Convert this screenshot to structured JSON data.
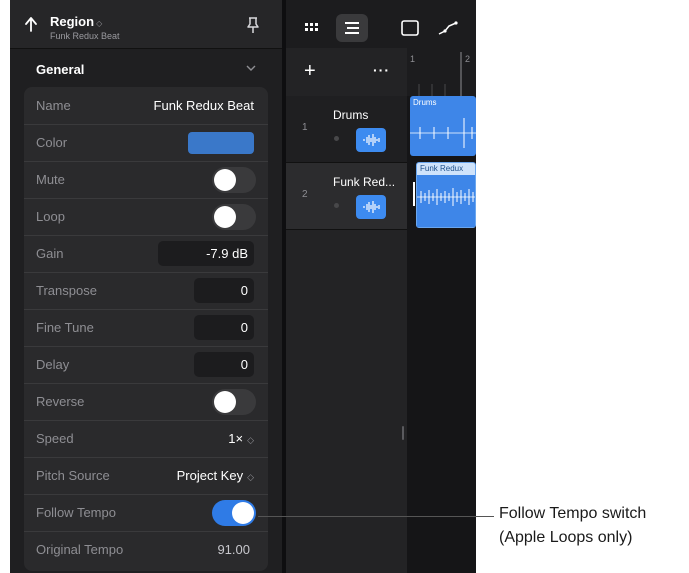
{
  "header": {
    "title": "Region",
    "title_chevron": "◇",
    "subtitle": "Funk Redux Beat",
    "back_icon": "back-arrow-icon",
    "pin_icon": "pin-icon"
  },
  "section": {
    "label": "General"
  },
  "rows": {
    "name": {
      "label": "Name",
      "value": "Funk Redux Beat"
    },
    "color": {
      "label": "Color",
      "value_color": "#3a78c9"
    },
    "mute": {
      "label": "Mute",
      "on": false
    },
    "loop": {
      "label": "Loop",
      "on": false
    },
    "gain": {
      "label": "Gain",
      "value": "-7.9 dB"
    },
    "transpose": {
      "label": "Transpose",
      "value": "0"
    },
    "fine_tune": {
      "label": "Fine Tune",
      "value": "0"
    },
    "delay": {
      "label": "Delay",
      "value": "0"
    },
    "reverse": {
      "label": "Reverse",
      "on": false
    },
    "speed": {
      "label": "Speed",
      "value": "1×"
    },
    "pitch_source": {
      "label": "Pitch Source",
      "value": "Project Key"
    },
    "follow_tempo": {
      "label": "Follow Tempo",
      "on": true
    },
    "original_tempo": {
      "label": "Original Tempo",
      "value": "91.00"
    }
  },
  "toolbar": {
    "buttons": [
      "grid-icon",
      "tracks-view-icon",
      "window-icon",
      "automation-icon"
    ],
    "add_label": "+",
    "more_label": "···"
  },
  "ruler": {
    "marks": [
      "1",
      "2"
    ]
  },
  "tracks": [
    {
      "number": "1",
      "name": "Drums",
      "region_label": "Drums"
    },
    {
      "number": "2",
      "name": "Funk Red...",
      "region_label": "Funk Redux"
    }
  ],
  "callout": {
    "line1": "Follow Tempo switch",
    "line2": "(Apple Loops only)"
  },
  "colors": {
    "accent": "#2f7be6",
    "region_blue": "#3e86e8",
    "background": "#1c1c1e"
  }
}
